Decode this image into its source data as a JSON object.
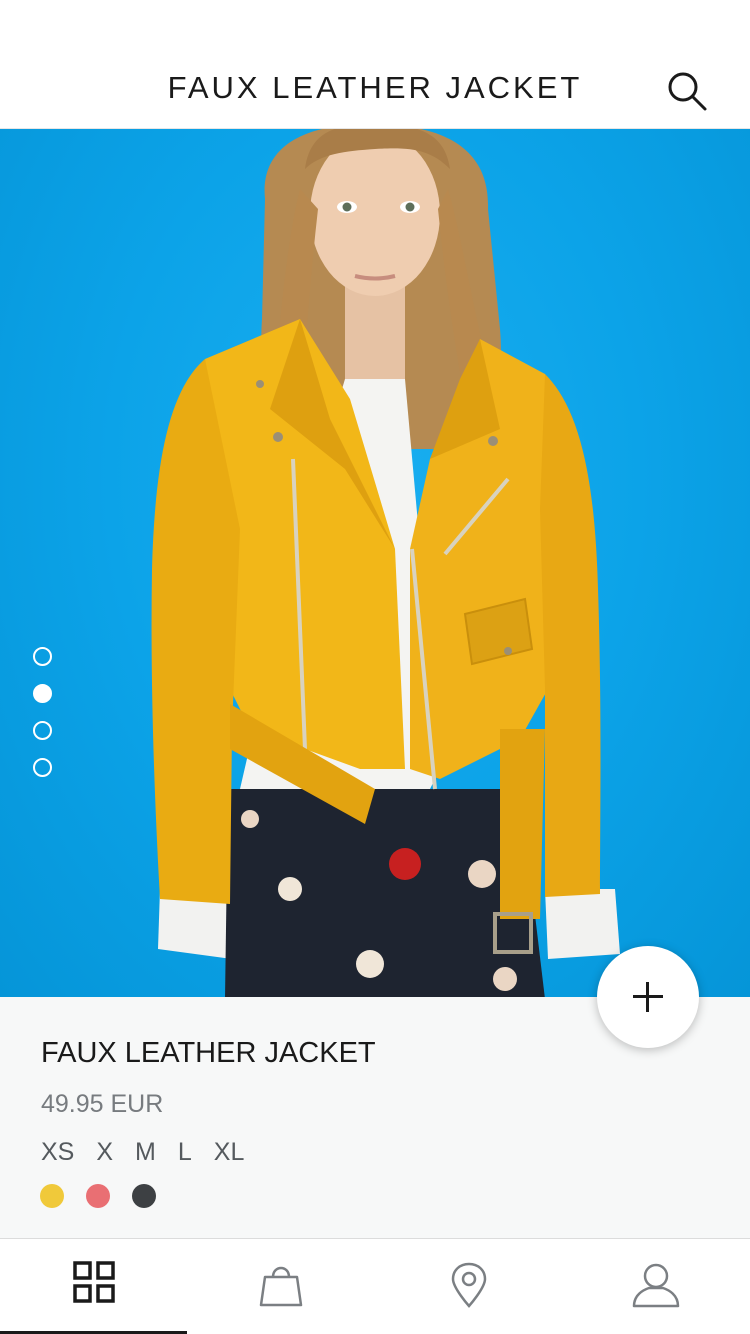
{
  "header": {
    "title": "FAUX LEATHER JACKET",
    "search_icon": "search-icon"
  },
  "hero": {
    "background_color": "#0ca3e8",
    "jacket_color": "#f2b718",
    "carousel": {
      "total": 4,
      "active_index": 1
    }
  },
  "product": {
    "name": "FAUX LEATHER JACKET",
    "price": "49.95 EUR",
    "sizes": [
      "XS",
      "X",
      "M",
      "L",
      "XL"
    ],
    "colors": [
      "#f0c93a",
      "#e96f73",
      "#3d4043"
    ]
  },
  "add_button": {
    "icon": "plus-icon"
  },
  "tabbar": {
    "tabs": [
      {
        "name": "grid-icon",
        "active": true
      },
      {
        "name": "bag-icon",
        "active": false
      },
      {
        "name": "location-pin-icon",
        "active": false
      },
      {
        "name": "user-icon",
        "active": false
      }
    ]
  }
}
